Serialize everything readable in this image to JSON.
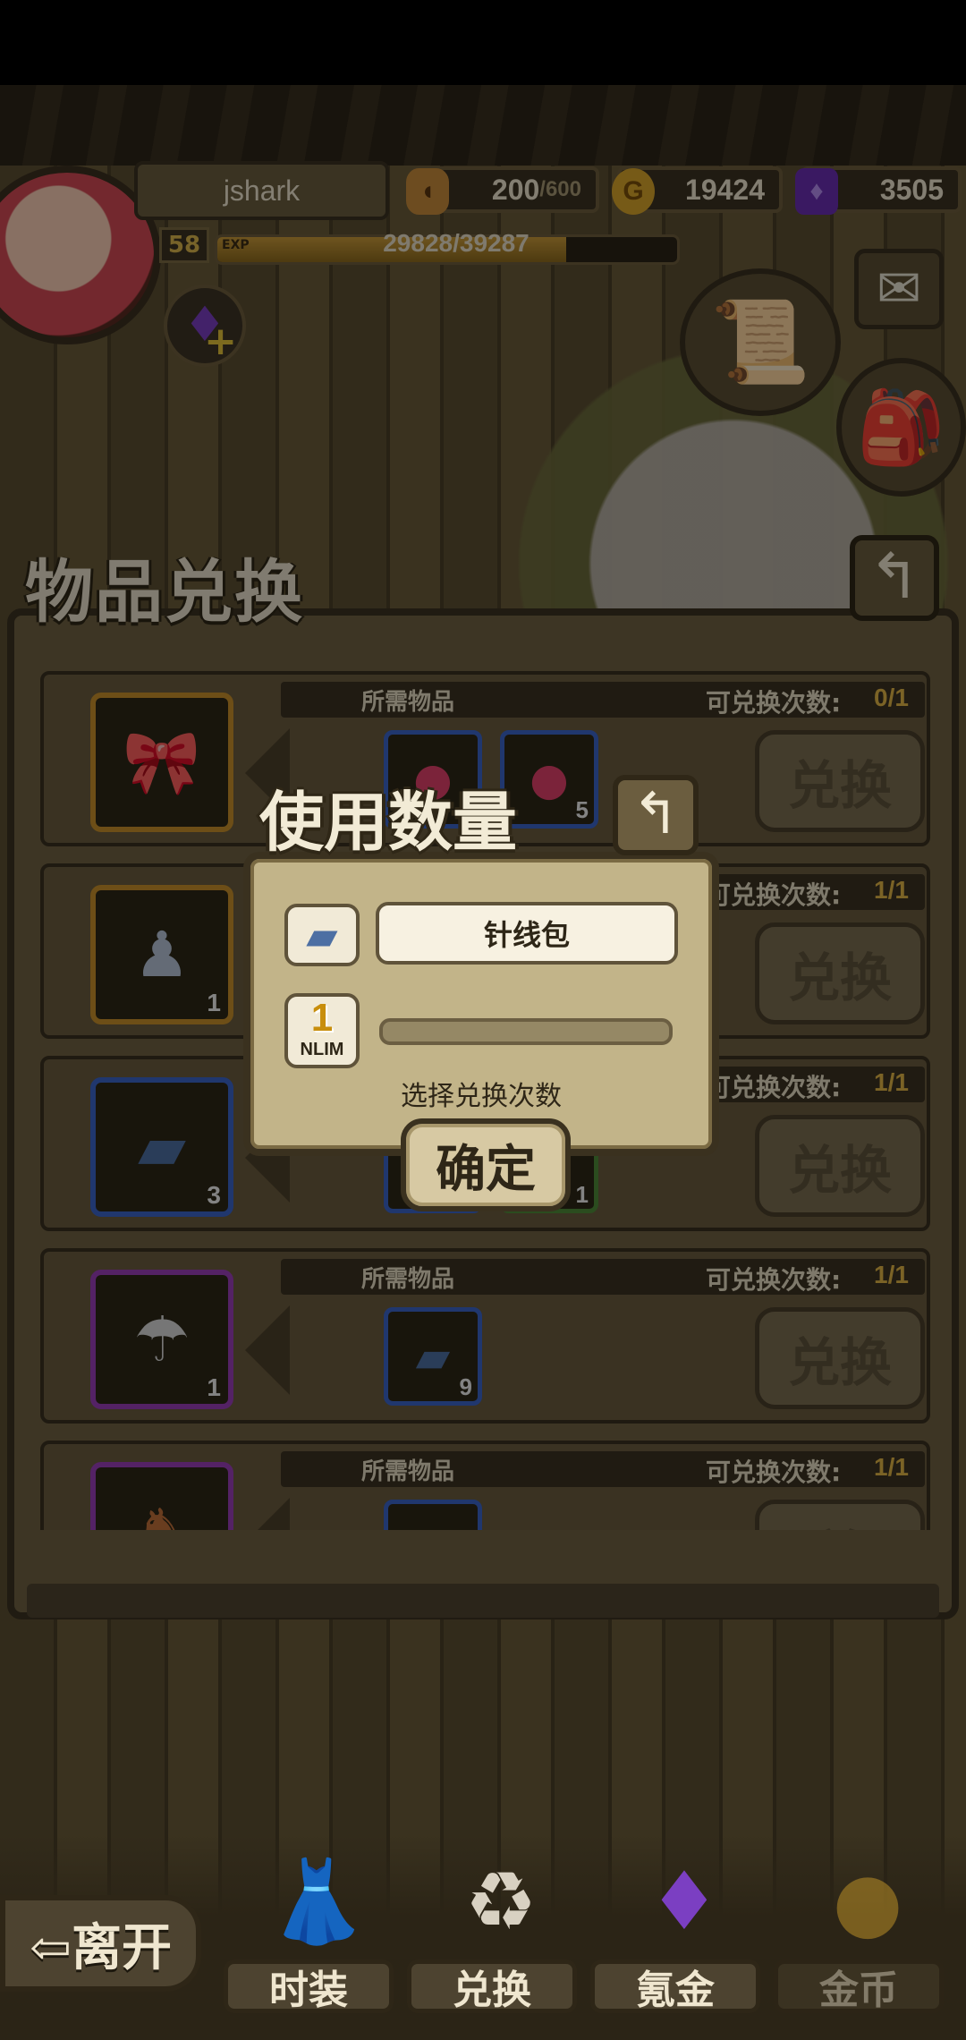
{
  "hud": {
    "player_name": "jshark",
    "level": "58",
    "exp_tag": "EXP",
    "exp_text": "29828/39287",
    "exp_fraction": 0.759,
    "stamina_current": "200",
    "stamina_max": "/600",
    "gold": "19424",
    "gems": "3505"
  },
  "panel": {
    "title": "物品兑换",
    "back_icon": "↰"
  },
  "rows": [
    {
      "req_label": "所需物品",
      "limit_label": "可兑换次数:",
      "limit_value": "0/1",
      "button": "兑换",
      "reward_icon": "bow",
      "reward_count": "",
      "materials": [
        {
          "icon": "egg-red",
          "count": ""
        },
        {
          "icon": "egg-red",
          "count": "5"
        }
      ]
    },
    {
      "req_label": "",
      "limit_label": "可兑换次数:",
      "limit_value": "1/1",
      "button": "兑换",
      "reward_icon": "figure-girl",
      "reward_count": "1",
      "materials": []
    },
    {
      "req_label": "",
      "limit_label": "可兑换次数:",
      "limit_value": "1/1",
      "button": "兑换",
      "reward_icon": "sewing-kit",
      "reward_count": "3",
      "materials": [
        {
          "icon": "egg-purple",
          "count": ""
        },
        {
          "icon": "cake",
          "count": "1"
        }
      ]
    },
    {
      "req_label": "所需物品",
      "limit_label": "可兑换次数:",
      "limit_value": "1/1",
      "button": "兑换",
      "reward_icon": "figure-umbrella",
      "reward_count": "1",
      "materials": [
        {
          "icon": "sewing-kit",
          "count": "9"
        }
      ]
    },
    {
      "req_label": "所需物品",
      "limit_label": "可兑换次数:",
      "limit_value": "1/1",
      "button": "兑",
      "reward_icon": "figure-antler",
      "reward_count": "",
      "materials": [
        {
          "icon": "sewing-kit",
          "count": ""
        }
      ]
    }
  ],
  "modal": {
    "title": "使用数量",
    "back_icon": "↰",
    "item_name": "针线包",
    "quantity": "1",
    "quantity_tag": "NLIM",
    "hint": "选择兑换次数",
    "confirm": "确定"
  },
  "nav": {
    "leave": "⇦离开",
    "tabs": [
      {
        "label": "时装",
        "icon": "dress-icon"
      },
      {
        "label": "兑换",
        "icon": "exchange-bag-icon"
      },
      {
        "label": "氪金",
        "icon": "gem-bag-icon"
      },
      {
        "label": "金币",
        "icon": "coin-bag-icon"
      }
    ]
  }
}
